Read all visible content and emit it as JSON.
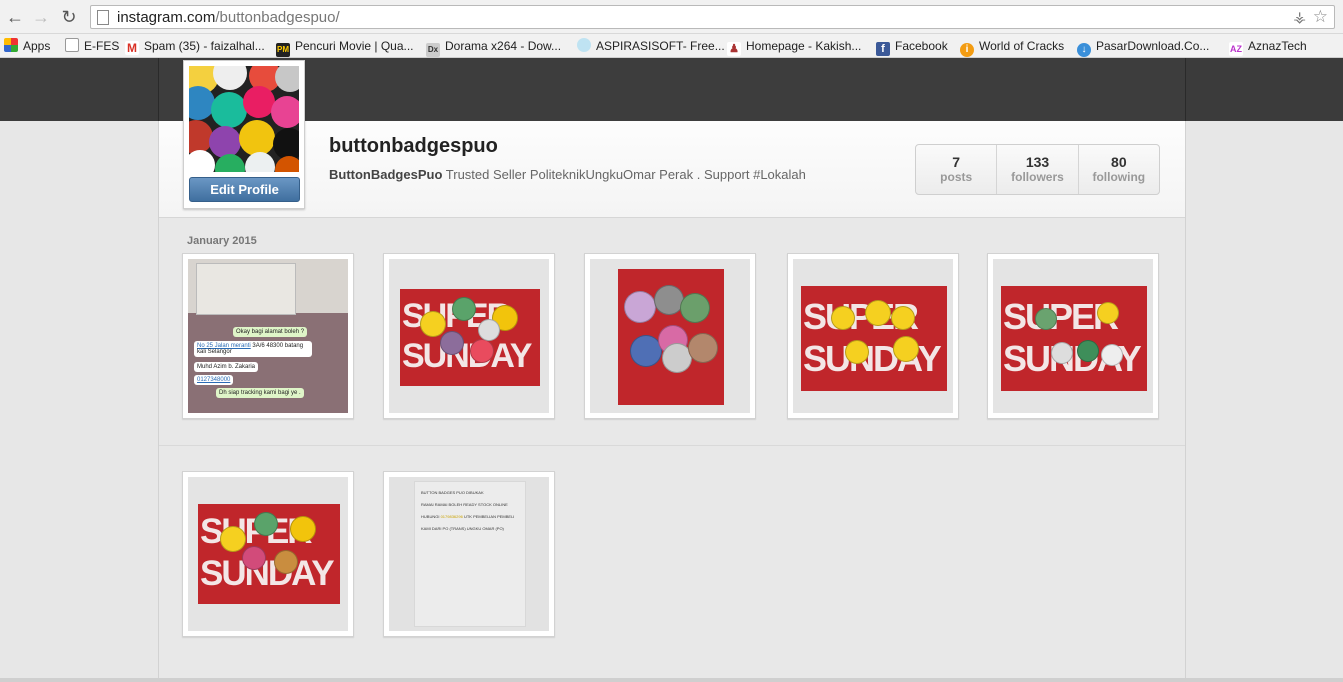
{
  "browser": {
    "url_host": "instagram.com",
    "url_path": "/buttonbadgespuo/",
    "bookmarks": [
      {
        "label": "Apps",
        "icon": "apps-grid-icon",
        "color": "#d44"
      },
      {
        "label": "E-FES",
        "icon": "page-icon",
        "color": "#999"
      },
      {
        "label": "Spam (35) - faizalhal...",
        "icon": "gmail-icon",
        "color": "#d93025"
      },
      {
        "label": "Pencuri Movie | Qua...",
        "icon": "pm-icon",
        "color": "#222"
      },
      {
        "label": "Dorama x264 - Dow...",
        "icon": "dx-icon",
        "color": "#888"
      },
      {
        "label": "ASPIRASISOFT- Free...",
        "icon": "drop-icon",
        "color": "#7ac"
      },
      {
        "label": "Homepage - Kakish...",
        "icon": "figure-icon",
        "color": "#a33"
      },
      {
        "label": "Facebook",
        "icon": "facebook-icon",
        "color": "#3b5998"
      },
      {
        "label": "World of Cracks",
        "icon": "info-icon",
        "color": "#f39c12"
      },
      {
        "label": "PasarDownload.Co...",
        "icon": "download-icon",
        "color": "#3a8fd9"
      },
      {
        "label": "AznazTech",
        "icon": "az-icon",
        "color": "#b3c"
      }
    ]
  },
  "profile": {
    "username": "buttonbadgespuo",
    "full_name": "ButtonBadgesPuo",
    "bio": "Trusted Seller PoliteknikUngkuOmar Perak . Support #Lokalah",
    "edit_label": "Edit Profile",
    "stats": [
      {
        "num": "7",
        "label": "posts"
      },
      {
        "num": "133",
        "label": "followers"
      },
      {
        "num": "80",
        "label": "following"
      }
    ]
  },
  "feed": {
    "month": "January 2015",
    "chat": {
      "msg1": "Okay bagi alamat boleh ?",
      "addr1": "No 25 Jalan meranti",
      "addr1_rest": " 3A/6 48300 batang kali Selangor",
      "name": "Muhd Azim b. Zakaria",
      "phone": "0127348000",
      "msg2": "Dh siap tracking kami bagi ye ."
    },
    "doc": {
      "line1": "BUTTON BADGES PUO DIBUKAK",
      "line2": "RAMAI RAMAI BOLEH READY STOCK ONLINE",
      "line3": "HUBUNGI",
      "line3_highlight": "0179836296",
      "line3_rest": "UTK PEMBELIAN PEMBELI",
      "line4": "KAMI DARI PO (TRANS) UNGKU OMAR (PO)"
    },
    "supersunday_word1": "SUPER",
    "supersunday_word2": "SUNDAY"
  },
  "colors": {
    "accent_button": "#3f6f9f",
    "card_red": "#c0262b"
  }
}
